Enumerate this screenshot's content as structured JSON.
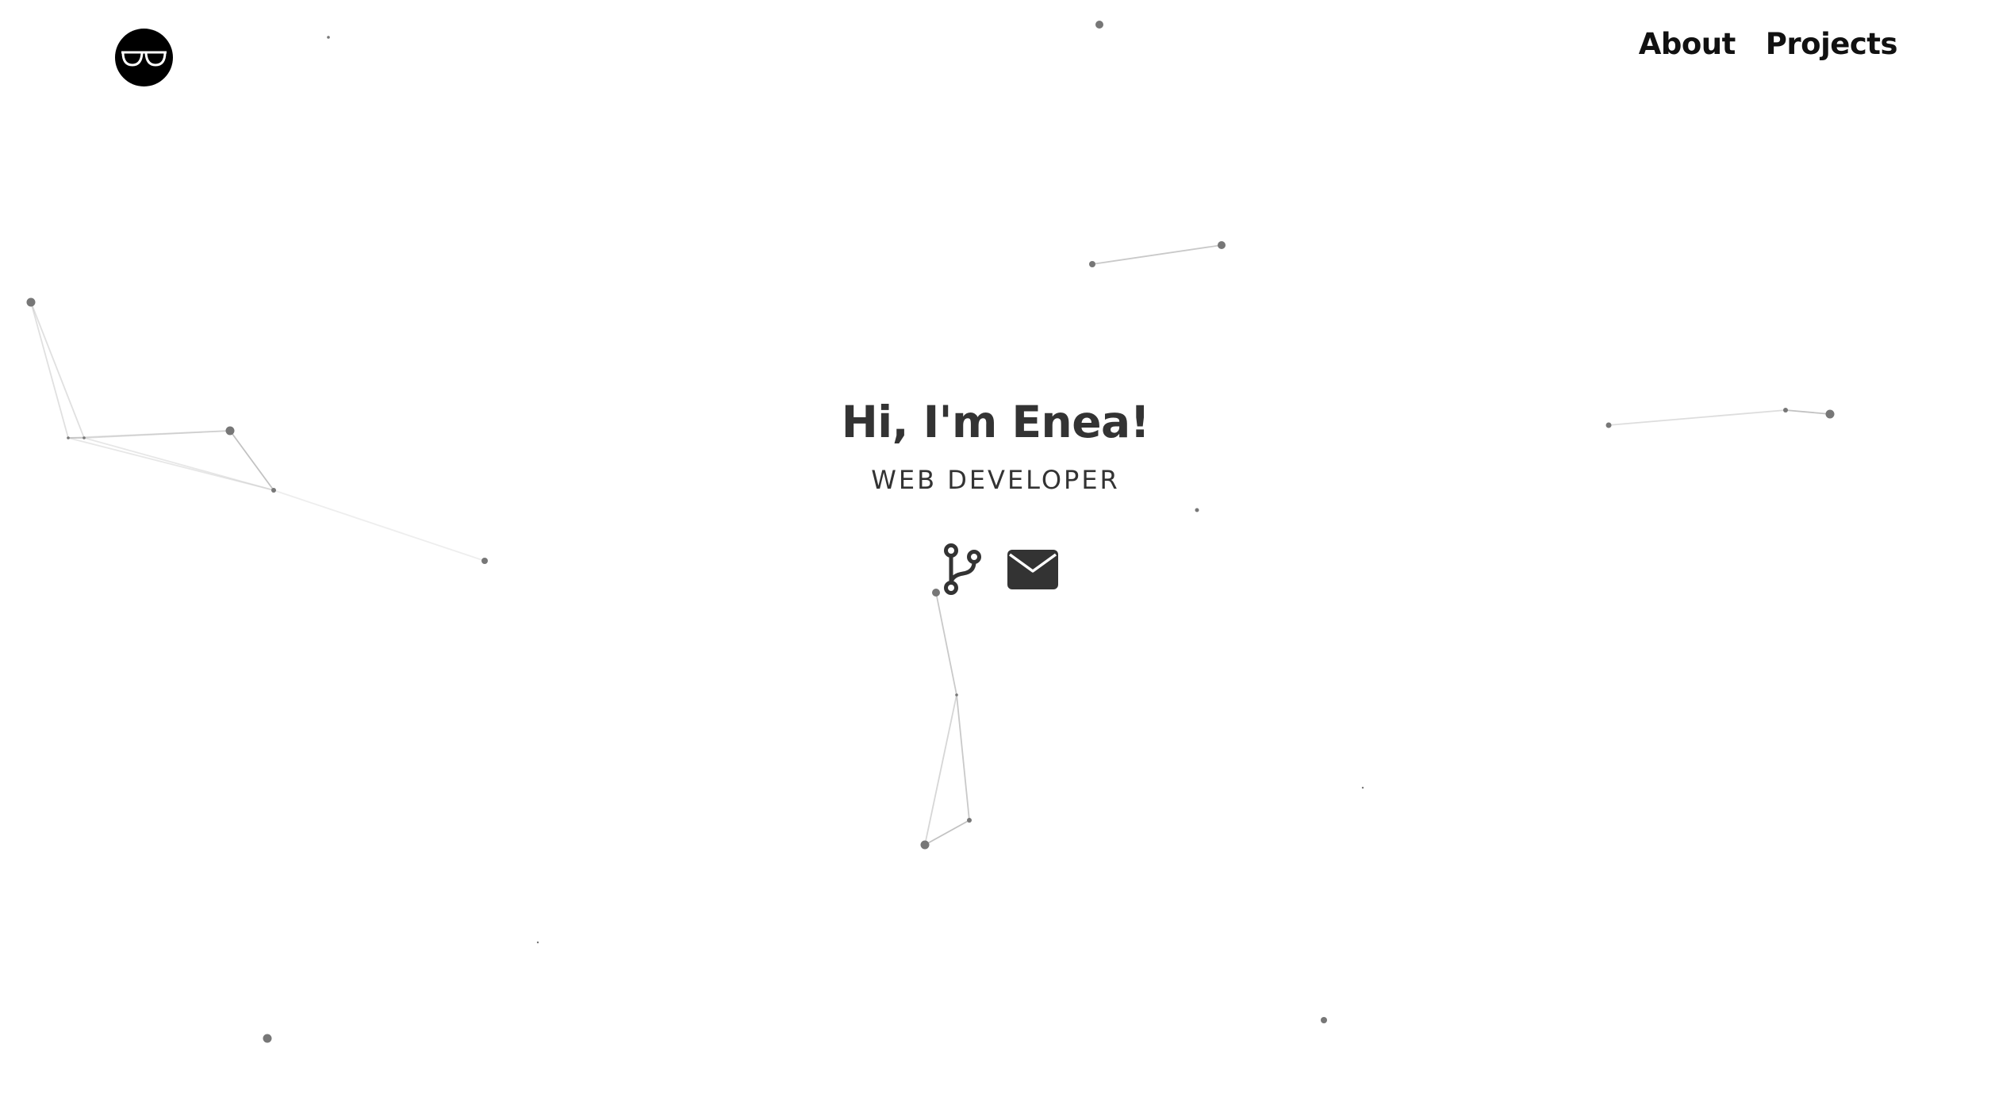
{
  "header": {
    "logo_icon": "glasses-icon",
    "nav": [
      {
        "label": "About"
      },
      {
        "label": "Projects"
      }
    ]
  },
  "hero": {
    "title": "Hi, I'm Enea!",
    "subtitle": "WEB DEVELOPER",
    "links": [
      {
        "icon": "git-branch-icon"
      },
      {
        "icon": "envelope-icon"
      }
    ]
  },
  "colors": {
    "background": "#ffffff",
    "text": "#333333",
    "particle": "#777777",
    "particle_line": "#bbbbbb",
    "logo_bg": "#000000"
  }
}
